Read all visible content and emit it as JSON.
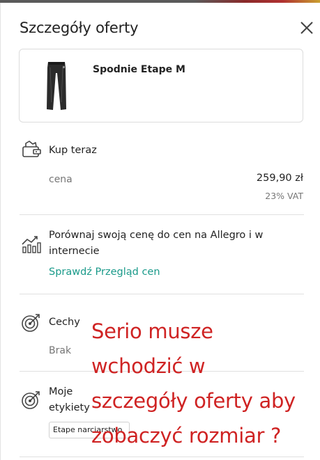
{
  "header": {
    "title": "Szczegóły oferty",
    "close_icon": "close-icon"
  },
  "product": {
    "name": "Spodnie Etape M",
    "thumbnail_icon": "pants-thumbnail"
  },
  "buy_now": {
    "icon": "wallet-icon",
    "title": "Kup teraz",
    "price_label": "cena",
    "price_value": "259,90 zł",
    "vat": "23% VAT"
  },
  "compare": {
    "icon": "chart-trend-icon",
    "text_line1": "Porównaj swoją cenę do cen na Allegro i w",
    "text_line2": "internecie",
    "link": "Sprawdź Przegląd cen"
  },
  "features": {
    "icon": "target-icon",
    "title": "Cechy",
    "value": "Brak"
  },
  "labels": {
    "icon": "target-icon",
    "title_line1": "Moje",
    "title_line2": "etykiety",
    "tag": "Etape narciarstwo"
  },
  "annotation": {
    "line1": "Serio musze",
    "line2": "wchodzić w",
    "line3": "szczegóły oferty aby",
    "line4": "zobaczyć rozmiar ?",
    "color": "#cf2323"
  },
  "colors": {
    "link": "#1a9a8a",
    "muted": "#767676",
    "text": "#222222"
  }
}
